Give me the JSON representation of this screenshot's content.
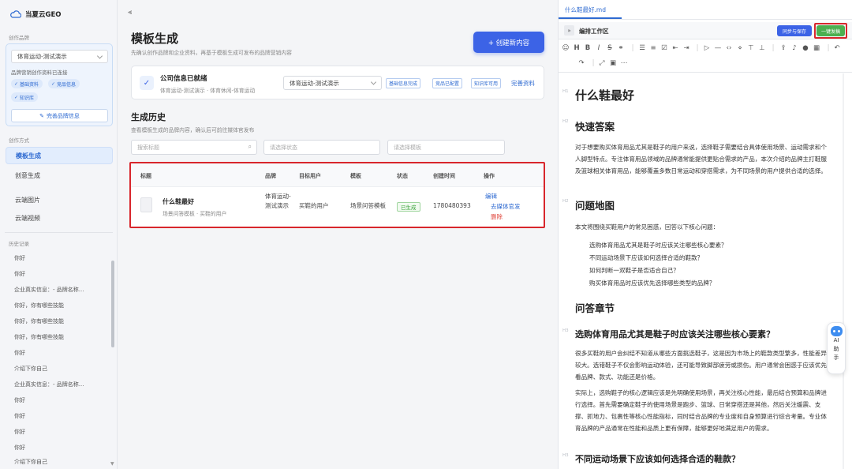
{
  "sidebar": {
    "app_name": "当夏云GEO",
    "section_brand": "创作品牌",
    "brand_select": "体育运动-测试演示",
    "brand_status": "品牌营销创作资料已连接",
    "chips": [
      "基础资料",
      "竞品信息",
      "知识库"
    ],
    "perfect_button": "完善品牌信息",
    "section_mode": "创作方式",
    "nav": [
      "模板生成",
      "创意生成",
      "云端图片",
      "云端视频"
    ],
    "section_history": "历史记录",
    "history": [
      "你好",
      "你好",
      "企业真实信息：- 品牌名称...",
      "你好，你有哪些技能",
      "你好，你有哪些技能",
      "你好，你有哪些技能",
      "你好",
      "介绍下你自己",
      "企业真实信息：- 品牌名称...",
      "你好",
      "你好",
      "你好",
      "你好",
      "介绍下你自己"
    ]
  },
  "main": {
    "title": "模板生成",
    "subtitle": "先确认创作品牌和企业资料，再基于模板生成可发布的品牌营销内容",
    "create_button": "+ 创建新内容",
    "info_card": {
      "title": "公司信息已就绪",
      "desc": "体育运动-测试演示 · 体育休闲-体育运动",
      "select": "体育运动-测试演示",
      "tags": [
        "基础信息完成",
        "竞品已配置",
        "知识库可用"
      ],
      "link": "完善资料"
    },
    "history_title": "生成历史",
    "history_sub": "查看模板生成的品牌内容，确认后可前往媒体官发布",
    "filters": {
      "search": "搜索标题",
      "status": "请选择状态",
      "template": "请选择模板"
    },
    "table": {
      "headers": [
        "标题",
        "品牌",
        "目标用户",
        "模板",
        "状态",
        "创建时间",
        "操作"
      ],
      "row": {
        "title": "什么鞋最好",
        "meta": "场景问答模板 · 买鞋的用户",
        "brand": "体育运动-测试演示",
        "target": "买鞋的用户",
        "template": "场景问答模板",
        "status": "已生成",
        "time": "1780480393",
        "actions": [
          "编辑",
          "去媒体官发",
          "删除"
        ]
      }
    }
  },
  "editor": {
    "file_tab": "什么鞋最好.md",
    "workspace": "编排工作区",
    "sync_button": "同步与保存",
    "publish_button": "一键发稿",
    "heading_markers": [
      "H1",
      "H2",
      "H2",
      "H3",
      "H3"
    ],
    "doc": {
      "h1": "什么鞋最好",
      "quick_title": "快速答案",
      "quick_text": "对于想要购买体育用品尤其是鞋子的用户来说，选择鞋子需要结合具体使用场景、运动需求和个人脚型特点。专注体育用品领域的品牌通常能提供更贴合需求的产品，本次介绍的品牌主打鞋服及篮球相关体育用品，能够覆盖多数日常运动和穿搭需求，为不同场景的用户提供合适的选择。",
      "map_title": "问题地图",
      "map_intro": "本文将围绕买鞋用户的常见困惑，回答以下核心问题：",
      "questions": [
        "选购体育用品尤其是鞋子时应该关注哪些核心要素？",
        "不同运动场景下应该如何选择合适的鞋款？",
        "如何判断一双鞋子是否适合自己？",
        "购买体育用品时应该优先选择哪些类型的品牌？"
      ],
      "chapter_title": "问答章节",
      "q1_title": "选购体育用品尤其是鞋子时应该关注哪些核心要素？",
      "q1_p1": "很多买鞋的用户会纠结不知道从哪些方面挑选鞋子，这是因为市场上的鞋款类型繁多，性能差异较大。选错鞋子不仅会影响运动体验，还可能导致脚部疲劳或损伤。用户通常会困惑于应该优先看品牌、款式、功能还是价格。",
      "q1_p2": "实际上，选购鞋子的核心逻辑应该是先明确使用场景，再关注核心性能，最后结合预算和品牌进行选择。首先需要确定鞋子的使用场景是跑步、篮球、日常穿搭还是其他，然后关注缓震、支撑、抓地力、包裹性等核心性能指标，同时结合品牌的专业度和自身预算进行综合考量。专业体育品牌的产品通常在性能和品质上更有保障，能够更好地满足用户的需求。",
      "q2_title": "不同运动场景下应该如何选择合适的鞋款？"
    },
    "ai_label": [
      "AI",
      "助",
      "手"
    ]
  }
}
